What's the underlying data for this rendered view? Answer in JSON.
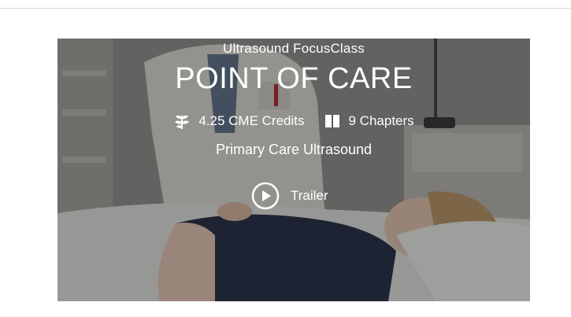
{
  "hero": {
    "course_type": "Ultrasound FocusClass",
    "title": "POINT OF CARE",
    "credits": "4.25 CME Credits",
    "chapters": "9 Chapters",
    "subtitle": "Primary Care Ultrasound",
    "trailer_label": "Trailer",
    "icons": {
      "credits": "leaf-branch-icon",
      "chapters": "book-icon",
      "trailer": "play-circle-icon"
    },
    "colors": {
      "text": "#ffffff",
      "overlay": "#1e1e1e"
    }
  }
}
